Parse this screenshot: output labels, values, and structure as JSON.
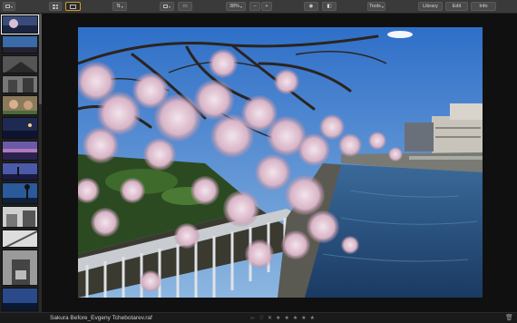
{
  "toolbar": {
    "zoom": "38%",
    "zoom_out": "−",
    "zoom_in": "+",
    "tools": "Tools",
    "library": "Library",
    "edit": "Edit",
    "info": "Info"
  },
  "image": {
    "filename": "Sakura Before_Evgeny Tchebotarev.raf"
  },
  "rating": {
    "flag_reject": "✕",
    "stars": [
      "★",
      "★",
      "★",
      "★",
      "★"
    ]
  }
}
